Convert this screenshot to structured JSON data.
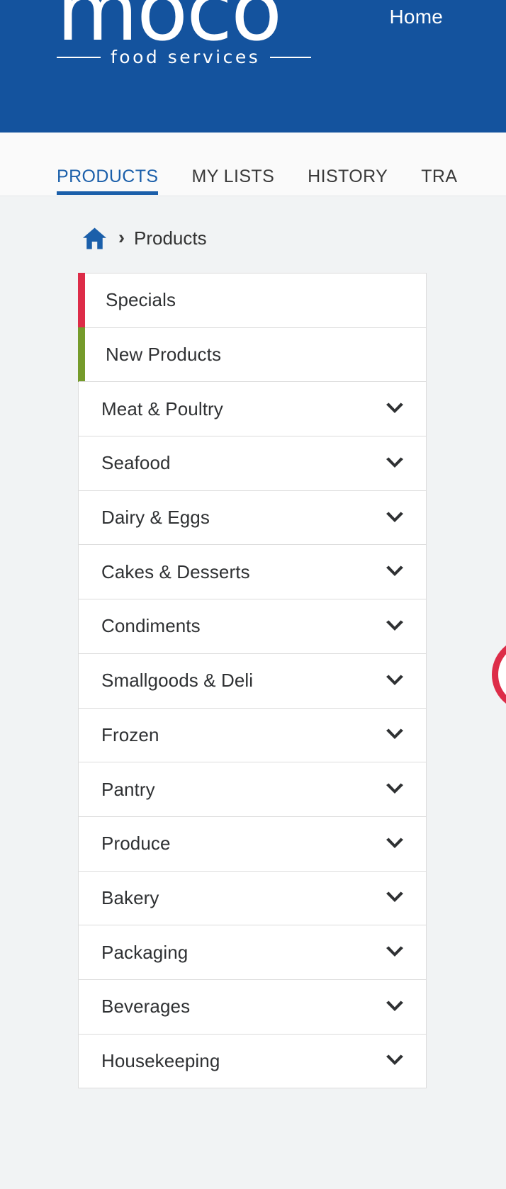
{
  "header": {
    "brand_name": "moco",
    "brand_tagline": "food services",
    "home_label": "Home",
    "background_color": "#14539e"
  },
  "tabs": [
    {
      "label": "PRODUCTS",
      "active": true
    },
    {
      "label": "MY LISTS",
      "active": false
    },
    {
      "label": "HISTORY",
      "active": false
    },
    {
      "label": "TRA",
      "active": false
    }
  ],
  "breadcrumb": {
    "home_icon": "home-icon",
    "separator": "›",
    "current": "Products"
  },
  "categories": [
    {
      "label": "Specials",
      "accent": "#dd2c48",
      "expandable": false
    },
    {
      "label": "New Products",
      "accent": "#759b2b",
      "expandable": false
    },
    {
      "label": "Meat & Poultry",
      "accent": "",
      "expandable": true
    },
    {
      "label": "Seafood",
      "accent": "",
      "expandable": true
    },
    {
      "label": "Dairy & Eggs",
      "accent": "",
      "expandable": true
    },
    {
      "label": "Cakes & Desserts",
      "accent": "",
      "expandable": true
    },
    {
      "label": "Condiments",
      "accent": "",
      "expandable": true
    },
    {
      "label": "Smallgoods & Deli",
      "accent": "",
      "expandable": true
    },
    {
      "label": "Frozen",
      "accent": "",
      "expandable": true
    },
    {
      "label": "Pantry",
      "accent": "",
      "expandable": true
    },
    {
      "label": "Produce",
      "accent": "",
      "expandable": true
    },
    {
      "label": "Bakery",
      "accent": "",
      "expandable": true
    },
    {
      "label": "Packaging",
      "accent": "",
      "expandable": true
    },
    {
      "label": "Beverages",
      "accent": "",
      "expandable": true
    },
    {
      "label": "Housekeeping",
      "accent": "",
      "expandable": true
    }
  ],
  "floating_button": {
    "icon": "circle-outline-icon",
    "color": "#dd2c48"
  },
  "colors": {
    "brand_blue": "#14539e",
    "tab_active_blue": "#1b5faa",
    "accent_red": "#dd2c48",
    "accent_green": "#759b2b",
    "page_background": "#f1f3f4",
    "card_background": "#ffffff"
  }
}
